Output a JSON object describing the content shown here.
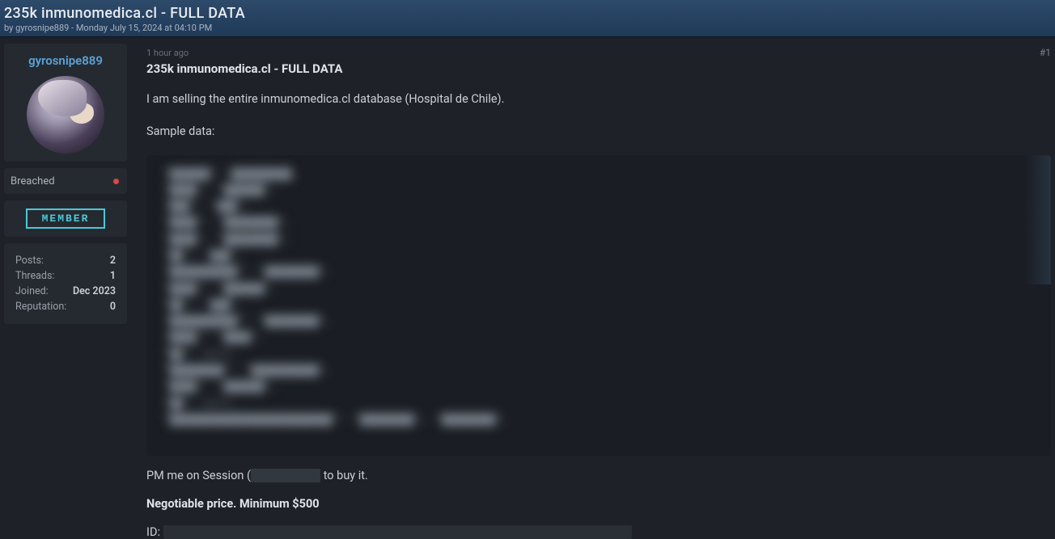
{
  "header": {
    "title": "235k inmunomedica.cl - FULL DATA",
    "byline_prefix": "by ",
    "author": "gyrosnipe889",
    "byline_separator": " - ",
    "timestamp": "Monday July 15, 2024 at 04:10 PM"
  },
  "user": {
    "name": "gyrosnipe889",
    "rank": "Breached",
    "badge": "MEMBER",
    "stats": {
      "posts_label": "Posts:",
      "posts_value": "2",
      "threads_label": "Threads:",
      "threads_value": "1",
      "joined_label": "Joined:",
      "joined_value": "Dec 2023",
      "reputation_label": "Reputation:",
      "reputation_value": "0"
    }
  },
  "post": {
    "time_ago": "1 hour ago",
    "number": "#1",
    "title": "235k inmunomedica.cl - FULL DATA",
    "intro": "I am selling the entire inmunomedica.cl database (Hospital de Chile).",
    "sample_label": "Sample data:",
    "pm_prefix": "PM me on Session (",
    "pm_redacted": "████████",
    "pm_suffix": " to buy it.",
    "price": "Negotiable price. Minimum $500",
    "id_label": "ID:",
    "id_redacted": "████████████████████████████████████████████████████████"
  }
}
